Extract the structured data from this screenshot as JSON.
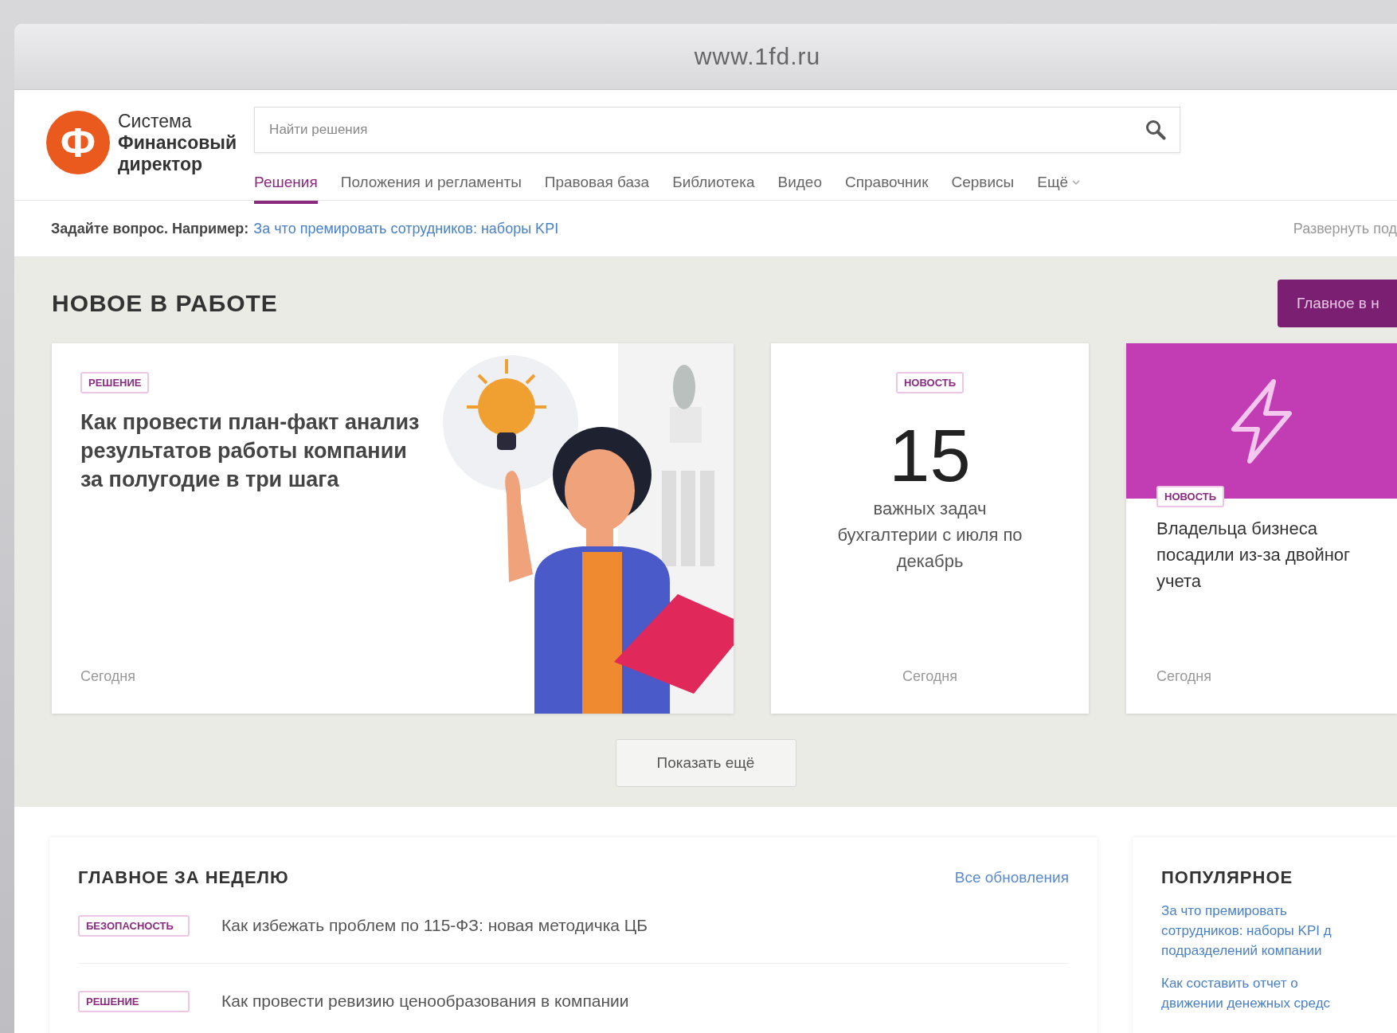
{
  "window": {
    "url": "www.1fd.ru"
  },
  "header": {
    "logo": {
      "glyph": "Ф",
      "line1": "Система",
      "line2": "Финансовый",
      "line3": "директор"
    },
    "search": {
      "placeholder": "Найти решения"
    },
    "nav": [
      {
        "label": "Решения",
        "selected": true,
        "kind": "link"
      },
      {
        "label": "Положения и регламенты",
        "selected": false,
        "kind": "link"
      },
      {
        "label": "Правовая база",
        "selected": false,
        "kind": "link"
      },
      {
        "label": "Библиотека",
        "selected": false,
        "kind": "link"
      },
      {
        "label": "Видео",
        "selected": false,
        "kind": "link"
      },
      {
        "label": "Справочник",
        "selected": false,
        "kind": "link"
      },
      {
        "label": "Сервисы",
        "selected": false,
        "kind": "link"
      },
      {
        "label": "Ещё",
        "selected": false,
        "kind": "dropdown"
      }
    ]
  },
  "ask_bar": {
    "prompt": "Задайте вопрос. Например:",
    "example": "За что премировать сотрудников: наборы KPI",
    "expand": "Развернуть под"
  },
  "new_section": {
    "title": "НОВОЕ В РАБОТЕ",
    "top_button": "Главное в н",
    "cards": [
      {
        "kind": "illustrated",
        "tag": "РЕШЕНИЕ",
        "title": "Как провести план-факт анализ результатов работы компании за полугодие в три шага",
        "date": "Сегодня"
      },
      {
        "kind": "number",
        "tag": "НОВОСТЬ",
        "number": "15",
        "text": "важных задач бухгалтерии с июля по декабрь",
        "date": "Сегодня"
      },
      {
        "kind": "banner",
        "tag": "НОВОСТЬ",
        "title": "Владельца бизнеса посадили из-за двойног учета",
        "date": "Сегодня"
      }
    ],
    "more_button": "Показать ещё"
  },
  "weekly": {
    "title": "ГЛАВНОЕ ЗА НЕДЕЛЮ",
    "all_link": "Все обновления",
    "items": [
      {
        "tag": "БЕЗОПАСНОСТЬ",
        "title": "Как избежать проблем по 115-ФЗ: новая методичка ЦБ"
      },
      {
        "tag": "РЕШЕНИЕ",
        "title": "Как провести ревизию ценообразования в компании"
      }
    ]
  },
  "popular": {
    "title": "ПОПУЛЯРНОЕ",
    "links": [
      {
        "lines": [
          "За что премировать",
          "сотрудников: наборы KPI д",
          "подразделений компании"
        ]
      },
      {
        "lines": [
          "Как составить отчет о",
          "движении денежных средс"
        ]
      }
    ]
  }
}
